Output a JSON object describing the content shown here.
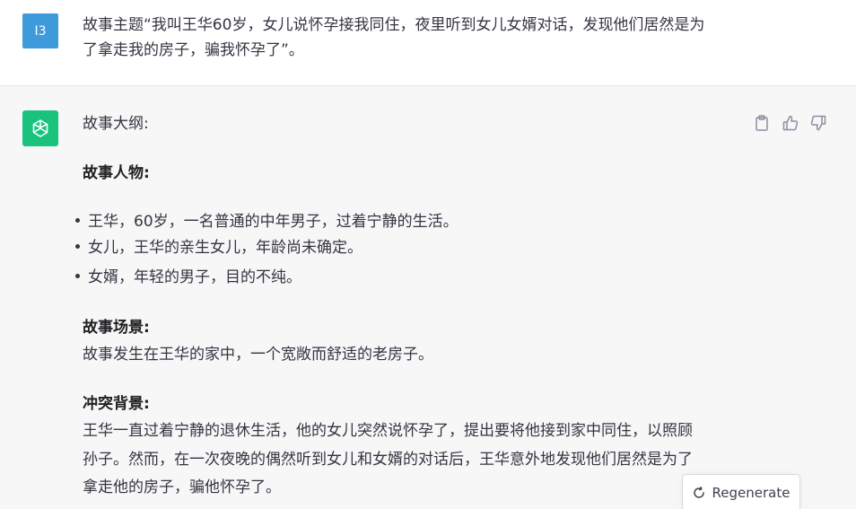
{
  "user_message": {
    "avatar_label": "I3",
    "lines": [
      "故事主题“我叫王华60岁，女儿说怀孕接我同住，夜里听到女儿女婿对话，发现他们居然是为",
      "了拿走我的房子，骗我怀孕了”。"
    ]
  },
  "assistant_message": {
    "intro": "故事大纲:",
    "characters_heading": "故事人物:",
    "characters": [
      "王华，60岁，一名普通的中年男子，过着宁静的生活。",
      "女儿，王华的亲生女儿，年龄尚未确定。",
      "女婿，年轻的男子，目的不纯。"
    ],
    "scene_heading": "故事场景:",
    "scene_text": "故事发生在王华的家中，一个宽敞而舒适的老房子。",
    "conflict_heading": "冲突背景:",
    "conflict_lines": [
      "王华一直过着宁静的退休生活，他的女儿突然说怀孕了，提出要将他接到家中同住，以照顾",
      "孙子。然而，在一次夜晚的偶然听到女儿和女婿的对话后，王华意外地发现他们居然是为了",
      "拿走他的房子，骗他怀孕了。"
    ]
  },
  "actions": {
    "copy_icon": "clipboard-icon",
    "thumbs_up_icon": "thumbs-up-icon",
    "thumbs_down_icon": "thumbs-down-icon"
  },
  "regenerate": {
    "label": "Regenerate",
    "icon": "refresh-icon"
  },
  "colors": {
    "user_avatar": "#3e9bdb",
    "gpt_avatar": "#19c37d",
    "assistant_bg": "#f7f7f8"
  }
}
